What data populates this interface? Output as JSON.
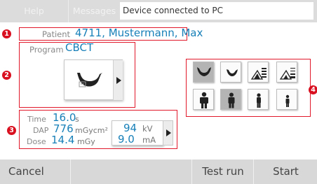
{
  "topbar": {
    "tabs": [
      {
        "label": "Help"
      },
      {
        "label": "Messages"
      }
    ],
    "status": "Device connected to PC"
  },
  "callouts": [
    "1",
    "2",
    "3",
    "4"
  ],
  "patient": {
    "label": "Patient",
    "value": "4711, Mustermann, Max"
  },
  "program": {
    "label": "Program",
    "value": "CBCT",
    "icon": "jaw-icon"
  },
  "mode_buttons": {
    "row1": [
      {
        "icon": "jaw-full-icon",
        "selected": true
      },
      {
        "icon": "jaw-partial-icon",
        "selected": false
      },
      {
        "icon": "bone-density-high-icon",
        "selected": false
      },
      {
        "icon": "bone-density-low-icon",
        "selected": false
      }
    ],
    "row2": [
      {
        "icon": "person-large-icon",
        "selected": false
      },
      {
        "icon": "person-medium-icon",
        "selected": true
      },
      {
        "icon": "person-small-icon",
        "selected": false
      },
      {
        "icon": "person-child-icon",
        "selected": false
      }
    ]
  },
  "exposure": {
    "time": {
      "label": "Time",
      "value": "16.0",
      "unit": "s"
    },
    "dap": {
      "label": "DAP",
      "value": "776",
      "unit": "mGycm²"
    },
    "dose": {
      "label": "Dose",
      "value": "14.4",
      "unit": "mGy"
    },
    "kv": {
      "value": "94",
      "unit": "kV"
    },
    "ma": {
      "value": "9.0",
      "unit": "mA"
    }
  },
  "bottombar": {
    "cancel": "Cancel",
    "test_run": "Test run",
    "start": "Start"
  },
  "colors": {
    "accent": "#1880b8",
    "callout": "#d9101f",
    "bar": "#d8d8d8"
  }
}
